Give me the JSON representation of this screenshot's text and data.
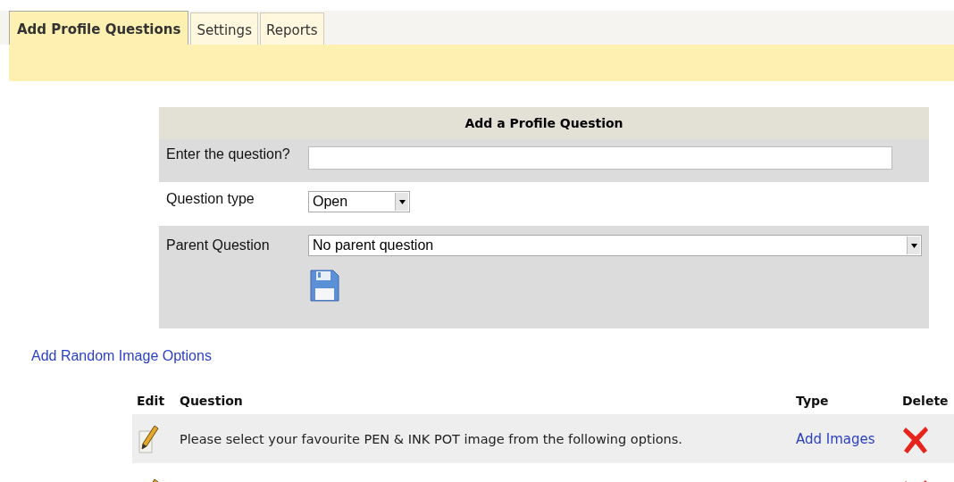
{
  "tabs": [
    {
      "label": "Add Profile Questions",
      "selected": true
    },
    {
      "label": "Settings",
      "selected": false
    },
    {
      "label": "Reports",
      "selected": false
    }
  ],
  "form": {
    "title": "Add a Profile Question",
    "question_label": "Enter the question?",
    "type_label": "Question type",
    "type_value": "Open",
    "parent_label": "Parent Question",
    "parent_value": "No parent question"
  },
  "random_link": "Add Random Image Options",
  "table": {
    "columns": [
      "Edit",
      "Question",
      "Type",
      "Delete"
    ],
    "rows": [
      {
        "question": "Please select your favourite PEN & INK POT image from the following options.",
        "type": "Add Images"
      },
      {}
    ]
  }
}
